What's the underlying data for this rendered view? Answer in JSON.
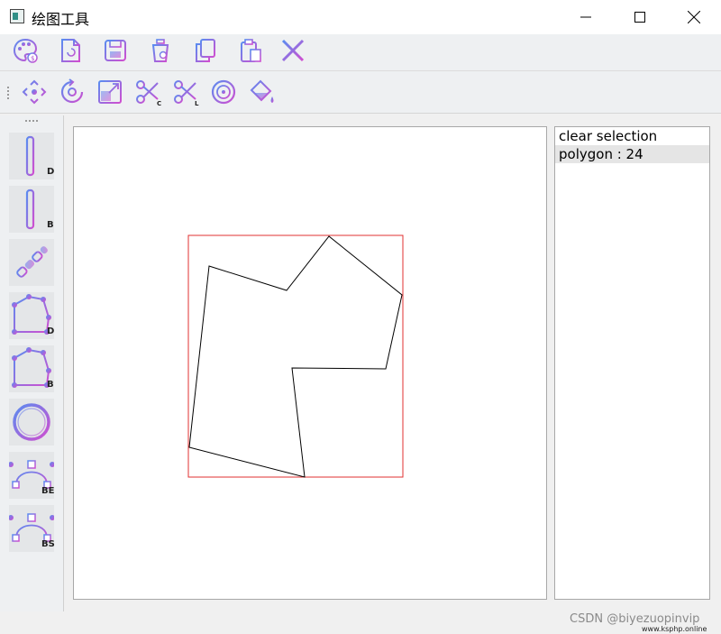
{
  "window": {
    "title": "绘图工具"
  },
  "titlebar_controls": [
    {
      "name": "minimize-button",
      "icon": "minimize-icon"
    },
    {
      "name": "maximize-button",
      "icon": "maximize-icon"
    },
    {
      "name": "close-button",
      "icon": "close-icon"
    }
  ],
  "toolbar_top": [
    {
      "name": "palette-tool",
      "icon": "palette-icon"
    },
    {
      "name": "new-file-tool",
      "icon": "new-file-icon"
    },
    {
      "name": "save-tool",
      "icon": "save-icon"
    },
    {
      "name": "clear-tool",
      "icon": "trash-icon"
    },
    {
      "name": "copy-tool",
      "icon": "copy-icon"
    },
    {
      "name": "paste-tool",
      "icon": "clipboard-icon"
    },
    {
      "name": "close-document-tool",
      "icon": "x-icon"
    }
  ],
  "toolbar_transform": [
    {
      "name": "translate-tool",
      "icon": "move-arrows-icon"
    },
    {
      "name": "rotate-tool",
      "icon": "rotate-icon"
    },
    {
      "name": "scale-tool",
      "icon": "scale-icon"
    },
    {
      "name": "clip-cohen-tool",
      "icon": "scissors-icon",
      "sub": "C"
    },
    {
      "name": "clip-liang-tool",
      "icon": "scissors-icon",
      "sub": "L"
    },
    {
      "name": "circle-target-tool",
      "icon": "target-icon"
    },
    {
      "name": "fill-tool",
      "icon": "paint-bucket-icon"
    }
  ],
  "draw_tools": [
    {
      "name": "line-dda-tool",
      "icon": "line-icon",
      "sub": "D"
    },
    {
      "name": "line-bresenham-tool",
      "icon": "line-icon",
      "sub": "B"
    },
    {
      "name": "segment-tool",
      "icon": "chain-icon",
      "sub": ""
    },
    {
      "name": "polygon-dda-tool",
      "icon": "polygon-icon",
      "sub": "D"
    },
    {
      "name": "polygon-bresenham-tool",
      "icon": "polygon-icon",
      "sub": "B"
    },
    {
      "name": "ellipse-tool",
      "icon": "ring-icon",
      "sub": ""
    },
    {
      "name": "curve-bezier-tool",
      "icon": "bezier-curve-icon",
      "sub": "BE"
    },
    {
      "name": "curve-bspline-tool",
      "icon": "bezier-curve-icon",
      "sub": "BS"
    }
  ],
  "shape_list": {
    "items": [
      "clear selection",
      "polygon : 24"
    ],
    "selected_index": 1
  },
  "watermark": {
    "text": "CSDN @biyezuopinvip",
    "site": "www.ksphp.online"
  },
  "colors": {
    "icon_gradient_start": "#5a8cf0",
    "icon_gradient_end": "#d04ed0",
    "selection_box": "#e23030",
    "shape_stroke": "#000000"
  }
}
